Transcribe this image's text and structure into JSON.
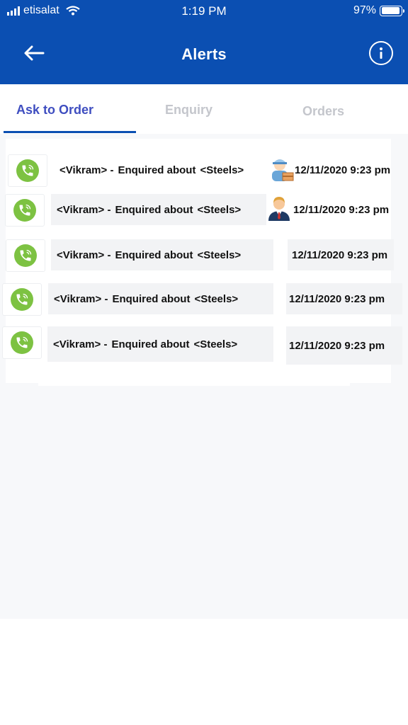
{
  "status_bar": {
    "carrier": "etisalat",
    "time": "1:19 PM",
    "battery": "97%",
    "signal_icon": "signal-bars-icon",
    "wifi_icon": "wifi-icon",
    "battery_icon": "battery-icon"
  },
  "header": {
    "title": "Alerts",
    "back_icon": "arrow-left-icon",
    "info_icon": "info-icon",
    "background_color": "#0b4fb2"
  },
  "tabs": [
    {
      "label": "Ask to Order",
      "active": true
    },
    {
      "label": "Enquiry",
      "active": false
    },
    {
      "label": "Orders",
      "active": false
    }
  ],
  "alerts": [
    {
      "customer": "<Vikram>",
      "separator": "-",
      "action": "Enquired about",
      "product": "<Steels>",
      "datetime": "12/11/2020 9:23 pm",
      "avatar": "delivery-worker-avatar-icon",
      "call_icon": "phone-call-icon"
    },
    {
      "customer": "<Vikram>",
      "separator": "-",
      "action": "Enquired about",
      "product": "<Steels>",
      "datetime": "12/11/2020 9:23 pm",
      "avatar": "businessman-avatar-icon",
      "call_icon": "phone-call-icon"
    },
    {
      "customer": "<Vikram>",
      "separator": "-",
      "action": "Enquired about",
      "product": "<Steels>",
      "datetime": "12/11/2020 9:23 pm",
      "avatar": "",
      "call_icon": "phone-call-icon"
    },
    {
      "customer": "<Vikram>",
      "separator": "-",
      "action": "Enquired about",
      "product": "<Steels>",
      "datetime": "12/11/2020 9:23 pm",
      "avatar": "",
      "call_icon": "phone-call-icon"
    },
    {
      "customer": "<Vikram>",
      "separator": "-",
      "action": "Enquired about",
      "product": "<Steels>",
      "datetime": "12/11/2020 9:23 pm",
      "avatar": "",
      "call_icon": "phone-call-icon"
    }
  ],
  "colors": {
    "accent": "#0b4fb2",
    "active_tab": "#3f4ec0",
    "inactive_tab": "#c4c6cc",
    "call_green": "#7dc242"
  }
}
